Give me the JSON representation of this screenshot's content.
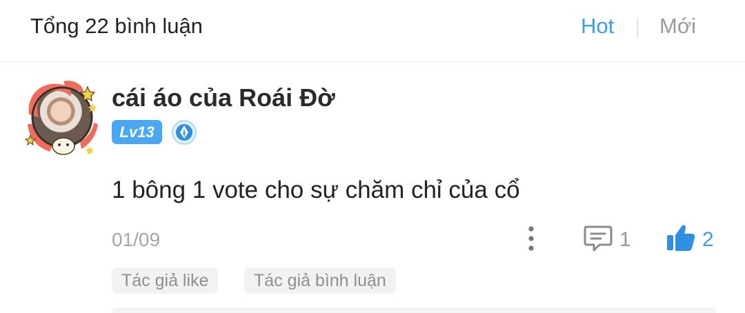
{
  "header": {
    "title": "Tổng 22 bình luận",
    "sort_hot": "Hot",
    "sort_new": "Mới"
  },
  "comment": {
    "username": "cái áo của Roái Đờ",
    "level": "Lv13",
    "text": "1 bông 1 vote cho sự chăm chỉ của cổ",
    "date": "01/09",
    "reply_count": "1",
    "like_count": "2",
    "tags": [
      "Tác giả like",
      "Tác giả bình luận"
    ]
  },
  "colors": {
    "accent": "#3b9ee8",
    "level_badge": "#4aa7f2",
    "muted": "#a5a5a5"
  },
  "icons": [
    "more-vertical-icon",
    "comment-icon",
    "thumbs-up-icon",
    "pen-badge-icon"
  ]
}
